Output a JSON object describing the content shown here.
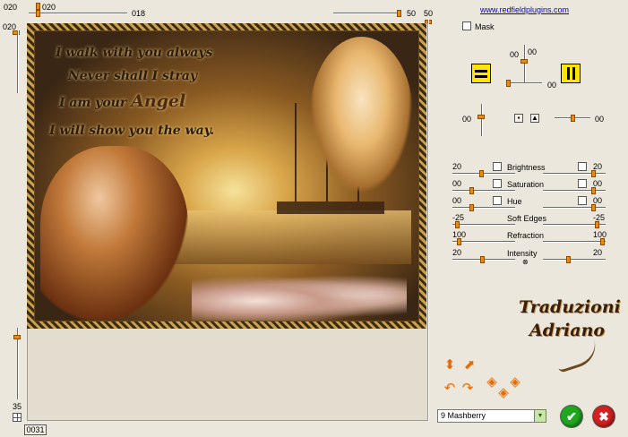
{
  "link_text": "www.redfieldplugins.com",
  "top_slider": {
    "left_value": "020",
    "knob_value": "020",
    "mid_value": "018",
    "right_value": "50",
    "far_value": "50"
  },
  "left_slider": {
    "top_value": "020",
    "bottom_value": "35"
  },
  "counter": "0031",
  "mask_label": "Mask",
  "mirror": {
    "top_a": "00",
    "top_b": "00",
    "right": "00",
    "left": "00",
    "far_right": "00"
  },
  "poem": {
    "line1": "I walk with you always",
    "line2": "Never shall I stray",
    "line3_a": "I am your",
    "line3_b": "Angel",
    "line4": "I will show you the way."
  },
  "adjustments": [
    {
      "label": "Brightness",
      "left": "20",
      "right": "20"
    },
    {
      "label": "Saturation",
      "left": "00",
      "right": "00"
    },
    {
      "label": "Hue",
      "left": "00",
      "right": "00"
    },
    {
      "label": "Soft Edges",
      "left": "-25",
      "right": "-25"
    },
    {
      "label": "Refraction",
      "left": "100",
      "right": "100"
    },
    {
      "label": "Intensity",
      "left": "20",
      "right": "20"
    }
  ],
  "signature": {
    "line1": "Traduzioni",
    "line2": "Adriano"
  },
  "preset": {
    "selected": "9 Mashberry"
  },
  "colors": {
    "knob": "#f28a00",
    "accent_yellow": "#ffe500",
    "ok_green": "#1fa81f",
    "cancel_red": "#d42020"
  },
  "icons": {
    "ok": "checkmark-icon",
    "cancel": "x-icon",
    "dropdown": "chevron-down-icon"
  }
}
